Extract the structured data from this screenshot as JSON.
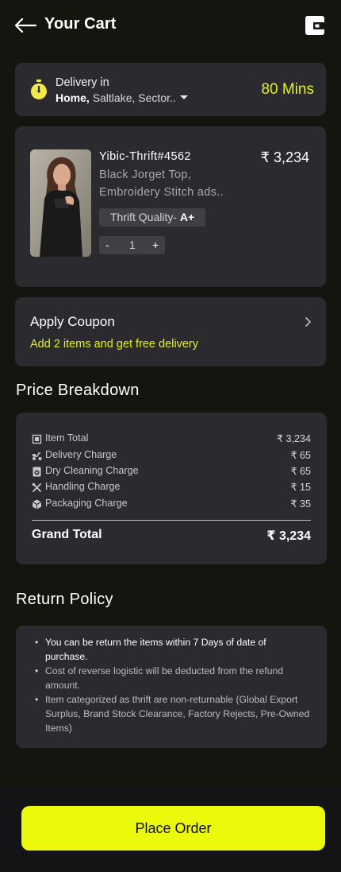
{
  "header": {
    "title": "Your Cart",
    "back_icon": "arrow-left-icon",
    "wallet_icon": "wallet-icon"
  },
  "delivery": {
    "label": "Delivery in",
    "place": "Home,",
    "address": "Saltlake, Sector..",
    "time": "80 Mins",
    "icon": "stopwatch-icon"
  },
  "product": {
    "name": "Yibic-Thrift#4562",
    "price": "₹ 3,234",
    "desc_line1": "Black Jorget Top,",
    "desc_line2": "Embroidery Stitch ads..",
    "quality_label": "Thrift Quality-",
    "quality_value": "A+",
    "qty_minus": "-",
    "quantity": "1",
    "qty_plus": "+"
  },
  "coupon": {
    "title": "Apply Coupon",
    "subtitle": "Add 2 items and get free delivery"
  },
  "breakdown": {
    "heading": "Price Breakdown",
    "rows": [
      {
        "label": "Item Total",
        "value": "₹ 3,234",
        "icon": "receipt-icon"
      },
      {
        "label": "Delivery Charge",
        "value": "₹ 65",
        "icon": "scooter-icon"
      },
      {
        "label": "Dry Cleaning Charge",
        "value": "₹ 65",
        "icon": "washing-machine-icon"
      },
      {
        "label": "Handling Charge",
        "value": "₹ 15",
        "icon": "tools-icon"
      },
      {
        "label": "Packaging Charge",
        "value": "₹ 35",
        "icon": "package-icon"
      }
    ],
    "grand_label": "Grand Total",
    "grand_value": "₹ 3,234"
  },
  "policy": {
    "heading": "Return Policy",
    "items": [
      "You can be return the items within 7 Days of date of purchase.",
      "Cost of reverse logistic will be deducted from the refund amount.",
      "Item categorized as thrift are non-returnable (Global Export Surplus, Brand Stock Clearance, Factory Rejects, Pre-Owned Items)"
    ]
  },
  "cta": {
    "label": "Place Order"
  },
  "colors": {
    "accent": "#e4f21a",
    "button": "#ebfa0a",
    "card": "#2b2b2f",
    "background": "#15150f"
  }
}
